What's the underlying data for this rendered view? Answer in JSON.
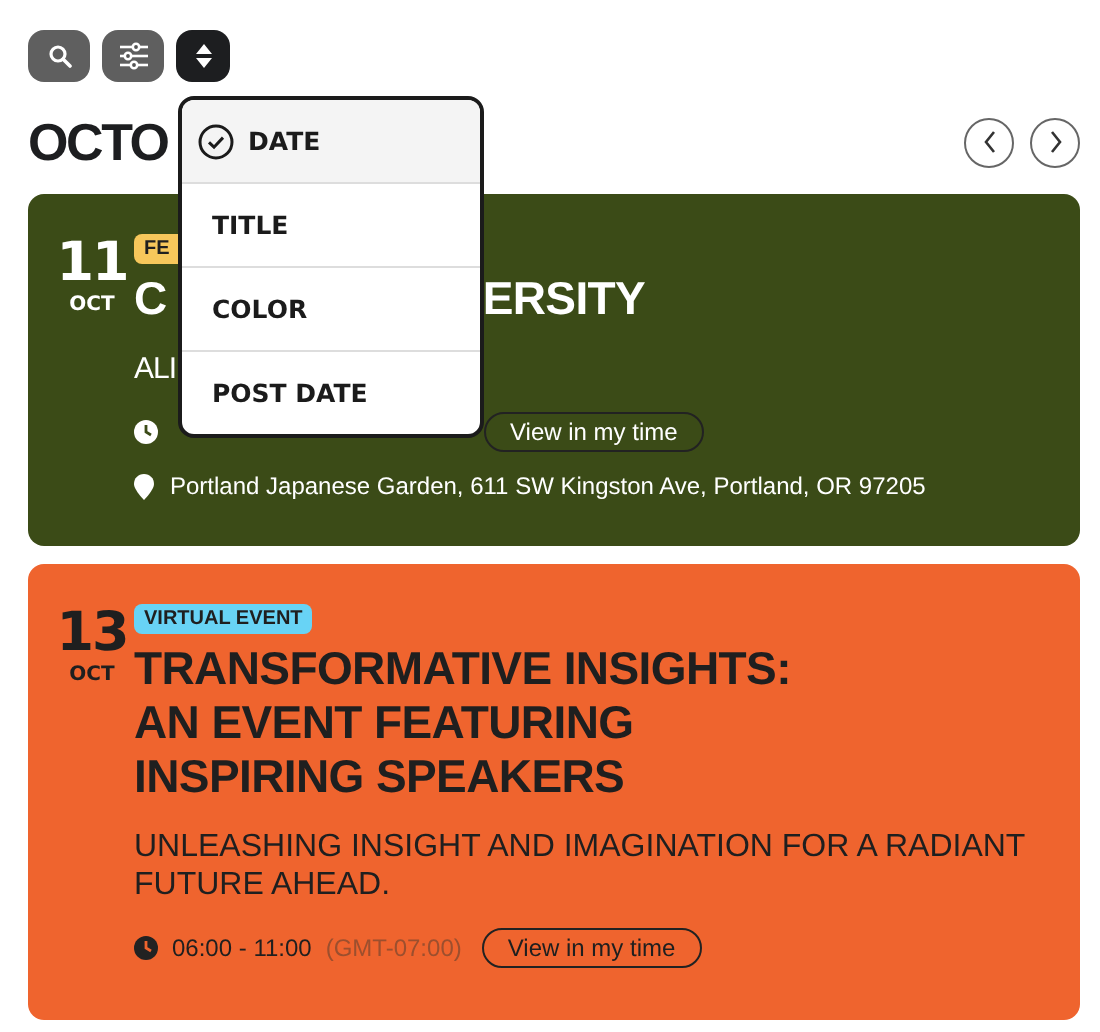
{
  "toolbar": [
    {
      "kind": "search",
      "selected": false
    },
    {
      "kind": "filter",
      "selected": false
    },
    {
      "kind": "sort",
      "selected": true
    }
  ],
  "heading": "OCTO",
  "sort_menu": [
    {
      "label": "DATE",
      "selected": true
    },
    {
      "label": "TITLE",
      "selected": false
    },
    {
      "label": "COLOR",
      "selected": false
    },
    {
      "label": "POST DATE",
      "selected": false
    }
  ],
  "events": [
    {
      "kind": "covered",
      "color": "#3b4b17",
      "day": "11",
      "month": "OCT",
      "badge": {
        "label": "FE",
        "color": "#f7c75b"
      },
      "title_pieces": [
        "C",
        "ERSITY"
      ],
      "subtitle": "ALI",
      "button": "View in my time",
      "location": "Portland Japanese Garden, 611 SW Kingston Ave, Portland, OR 97205"
    },
    {
      "kind": "full",
      "color": "#ef642e",
      "day": "13",
      "month": "OCT",
      "badge": {
        "label": "VIRTUAL EVENT",
        "color": "#68d3f5"
      },
      "title_lines": [
        "TRANSFORMATIVE INSIGHTS:",
        "AN EVENT FEATURING",
        "INSPIRING SPEAKERS"
      ],
      "subtitle": "UNLEASHING INSIGHT AND IMAGINATION FOR A RADIANT FUTURE AHEAD.",
      "time": "06:00 - 11:00",
      "zone": "(GMT-07:00)",
      "button": "View in my time"
    }
  ]
}
